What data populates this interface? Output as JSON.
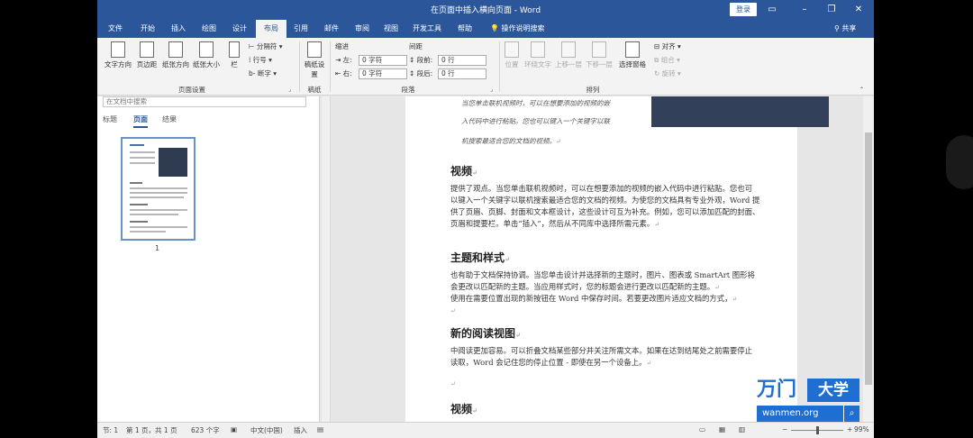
{
  "window": {
    "title": "在页面中插入横向页面 - Word",
    "login": "登录",
    "minimize": "–",
    "restore": "❐",
    "close": "✕"
  },
  "tabs": [
    {
      "label": "文件"
    },
    {
      "label": "开始"
    },
    {
      "label": "插入"
    },
    {
      "label": "绘图"
    },
    {
      "label": "设计"
    },
    {
      "label": "布局"
    },
    {
      "label": "引用"
    },
    {
      "label": "邮件"
    },
    {
      "label": "审阅"
    },
    {
      "label": "视图"
    },
    {
      "label": "开发工具"
    },
    {
      "label": "帮助"
    }
  ],
  "active_tab": "布局",
  "tell_me": "操作说明搜索",
  "share": "共享",
  "ribbon": {
    "page_setup": {
      "text_direction": "文字方向",
      "margins": "页边距",
      "orientation": "纸张方向",
      "size": "纸张大小",
      "columns": "栏",
      "breaks": "分隔符",
      "line_numbers": "行号",
      "hyphenation": "断字",
      "group_label": "页面设置"
    },
    "manuscript": {
      "button": "稿纸设置",
      "group_label": "稿纸"
    },
    "paragraph": {
      "indent_label": "缩进",
      "spacing_label": "间距",
      "left_label": "左:",
      "left_value": "0 字符",
      "right_label": "右:",
      "right_value": "0 字符",
      "before_label": "段前:",
      "before_value": "0 行",
      "after_label": "段后:",
      "after_value": "0 行",
      "group_label": "段落"
    },
    "arrange": {
      "position": "位置",
      "wrap_text": "环绕文字",
      "bring_forward": "上移一层",
      "send_backward": "下移一层",
      "selection_pane": "选择窗格",
      "align": "对齐",
      "group": "组合",
      "rotate": "旋转",
      "group_label": "排列"
    }
  },
  "nav": {
    "search_placeholder": "在文档中搜索",
    "tabs": [
      "标题",
      "页面",
      "结果"
    ],
    "active_tab": "页面",
    "page_number": "1"
  },
  "document": {
    "captions": [
      "当您单击联机视频时，可以在想要添加的视频的嵌",
      "入代码中进行粘贴。您也可以键入一个关键字以联",
      "机搜索最适合您的文档的视频。"
    ],
    "sections": [
      {
        "heading": "视频",
        "lines": [
          "提供了观点。当您单击联机视频时，可以在想要添加的视频的嵌入代码中进行粘贴。您也可",
          "以键入一个关键字以联机搜索最适合您的文档的视频。为使您的文档具有专业外观，Word 提",
          "供了页眉、页脚、封面和文本框设计，这些设计可互为补充。例如，您可以添加匹配的封面、",
          "页眉和提要栏。单击“插入”，然后从不同库中选择所需元素。"
        ]
      },
      {
        "heading": "主题和样式",
        "lines": [
          "也有助于文档保持协调。当您单击设计并选择新的主题时，图片、图表或 SmartArt 图形将",
          "会更改以匹配新的主题。当应用样式时，您的标题会进行更改以匹配新的主题。",
          "使用在需要位置出现的新按钮在 Word 中保存时间。若要更改图片适应文档的方式，"
        ]
      },
      {
        "heading": "新的阅读视图",
        "lines": [
          "中阅读更加容易。可以折叠文档某些部分并关注所需文本。如果在达到结尾处之前需要停止",
          "读取，Word 会记住您的停止位置 - 即使在另一个设备上。"
        ]
      },
      {
        "heading": "视频",
        "lines": []
      }
    ],
    "para_mark": "↵"
  },
  "status": {
    "section": "节: 1",
    "page": "第 1 页，共 1 页",
    "words": "623 个字",
    "language": "中文(中国)",
    "insert_mode": "插入",
    "zoom": "99%",
    "zoom_minus": "−",
    "zoom_plus": "+"
  },
  "watermark": {
    "logo": "万门",
    "name": "大学",
    "url": "wanmen.org",
    "search_icon": "search-icon"
  },
  "colors": {
    "accent": "#2b579a",
    "watermark": "#1e6fd1"
  }
}
